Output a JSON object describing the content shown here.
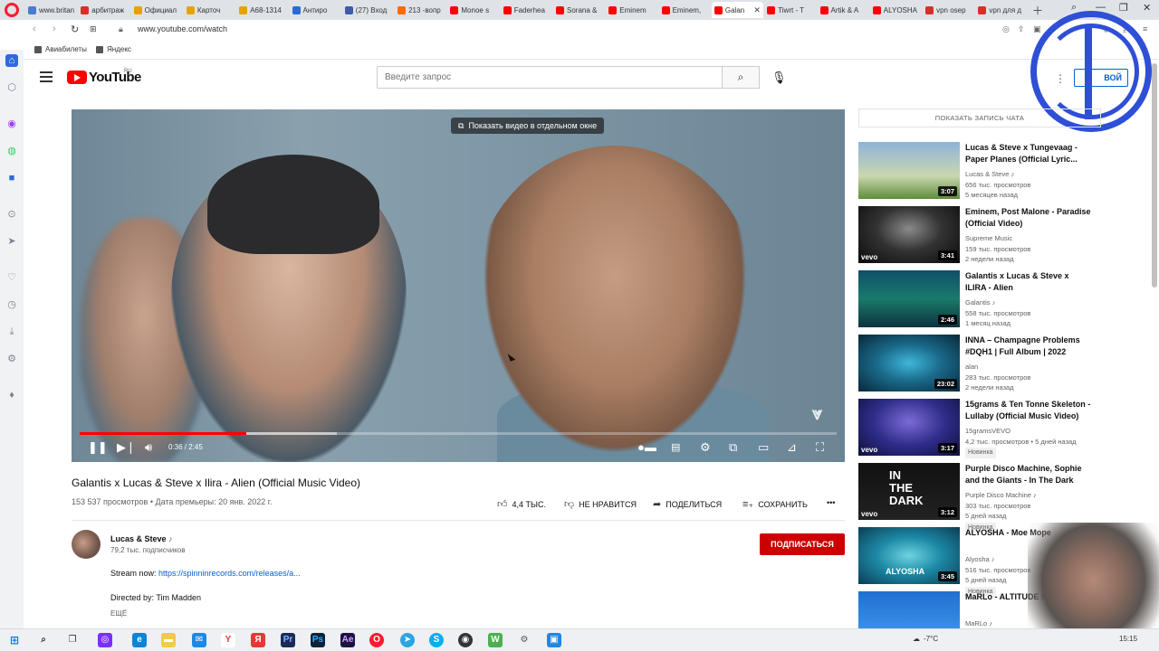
{
  "browser": {
    "tabs": [
      {
        "label": "www.britan",
        "color": "#4a7bd0"
      },
      {
        "label": "арбитраж",
        "color": "#d93025"
      },
      {
        "label": "Официал",
        "color": "#e8a200"
      },
      {
        "label": "Карточ",
        "color": "#e8a200"
      },
      {
        "label": "А68-1314",
        "color": "#e8a200"
      },
      {
        "label": "Антиро",
        "color": "#2a6bd3"
      },
      {
        "label": "(27) Вход",
        "color": "#3c5ba8"
      },
      {
        "label": "213 -вопр",
        "color": "#ff6a00"
      },
      {
        "label": "Monoe s",
        "color": "#ff0000"
      },
      {
        "label": "Faderhea",
        "color": "#ff0000"
      },
      {
        "label": "Sorana &",
        "color": "#ff0000"
      },
      {
        "label": "Eminem",
        "color": "#ff0000"
      },
      {
        "label": "Eminem,",
        "color": "#ff0000"
      },
      {
        "label": "Galan",
        "color": "#ff0000",
        "active": true
      },
      {
        "label": "Tiwrt - T",
        "color": "#ff0000"
      },
      {
        "label": "Artik & A",
        "color": "#ff0000"
      },
      {
        "label": "ALYOSHA",
        "color": "#ff0000"
      },
      {
        "label": "vpn osep",
        "color": "#d93025"
      },
      {
        "label": "vpn для д",
        "color": "#d93025"
      }
    ],
    "url": "www.youtube.com/watch",
    "bookmarks": [
      "Авиабилеты",
      "Яндекс"
    ]
  },
  "youtube": {
    "logo_text": "YouTube",
    "logo_region": "RU",
    "search_placeholder": "Введите запрос",
    "signin_label": "ВОЙ",
    "video": {
      "pip_label": "Показать видео в отдельном окне",
      "time": "0:36 / 2:45",
      "played_fraction": 0.22,
      "buffered_fraction": 0.34
    },
    "title": "Galantis x Lucas & Steve x Ilira - Alien (Official Music Video)",
    "meta": "153 537 просмотров • Дата премьеры: 20 янв. 2022 г.",
    "actions": {
      "likes": "4,4 ТЫС.",
      "dislike": "НЕ НРАВИТСЯ",
      "share": "ПОДЕЛИТЬСЯ",
      "save": "СОХРАНИТЬ"
    },
    "channel": {
      "name": "Lucas & Steve",
      "note_icon": "♪",
      "subscribers": "79,2 тыс. подписчиков",
      "subscribe_label": "ПОДПИСАТЬСЯ"
    },
    "description": {
      "stream_prefix": "Stream now: ",
      "stream_link": "https://spinninrecords.com/releases/a...",
      "directed": "Directed by: Tim Madden",
      "more": "ЕЩЁ"
    },
    "chat_replay": "ПОКАЗАТЬ ЗАПИСЬ ЧАТА",
    "recommendations": [
      {
        "title": "Lucas & Steve x Tungevaag - Paper Planes (Official Lyric...",
        "channel": "Lucas & Steve ♪",
        "views": "656 тыс. просмотров",
        "age": "5 месяцев назад",
        "duration": "3:07",
        "badge": "",
        "vevo": false
      },
      {
        "title": "Eminem, Post Malone - Paradise (Official Video)",
        "channel": "Supreme Music",
        "views": "159 тыс. просмотров",
        "age": "2 недели назад",
        "duration": "3:41",
        "badge": "",
        "vevo": true
      },
      {
        "title": "Galantis x Lucas & Steve x ILIRA - Alien",
        "channel": "Galantis ♪",
        "views": "558 тыс. просмотров",
        "age": "1 месяц назад",
        "duration": "2:46",
        "badge": "",
        "vevo": false
      },
      {
        "title": "INNA – Champagne Problems #DQH1 | Full Album | 2022",
        "channel": "alan",
        "views": "283 тыс. просмотров",
        "age": "2 недели назад",
        "duration": "23:02",
        "badge": "",
        "vevo": false
      },
      {
        "title": "15grams & Ten Tonne Skeleton - Lullaby (Official Music Video)",
        "channel": "15gramsVEVO",
        "views": "4,2 тыс. просмотров • 5 дней назад",
        "age": "",
        "duration": "3:17",
        "badge": "Новинка",
        "vevo": true
      },
      {
        "title": "Purple Disco Machine, Sophie and the Giants - In The Dark",
        "channel": "Purple Disco Machine ♪",
        "views": "303 тыс. просмотров",
        "age": "5 дней назад",
        "duration": "3:12",
        "badge": "Новинка",
        "vevo": true
      },
      {
        "title": "ALYOSHA - Мое Море",
        "channel": "Alyosha ♪",
        "views": "516 тыс. просмотров",
        "age": "5 дней назад",
        "duration": "3:45",
        "badge": "Новинка",
        "vevo": false
      },
      {
        "title": "MaRLo - ALTITUDE Me...",
        "channel": "MaRLo ♪",
        "views": "",
        "age": "",
        "duration": "",
        "badge": "",
        "vevo": false
      }
    ],
    "thumb_art": {
      "in_the_dark_1": "IN",
      "in_the_dark_2": "THE",
      "in_the_dark_3": "DARK",
      "alyosha": "ALYOSHA"
    }
  },
  "taskbar": {
    "weather": "-7°C",
    "time": "15:15"
  }
}
